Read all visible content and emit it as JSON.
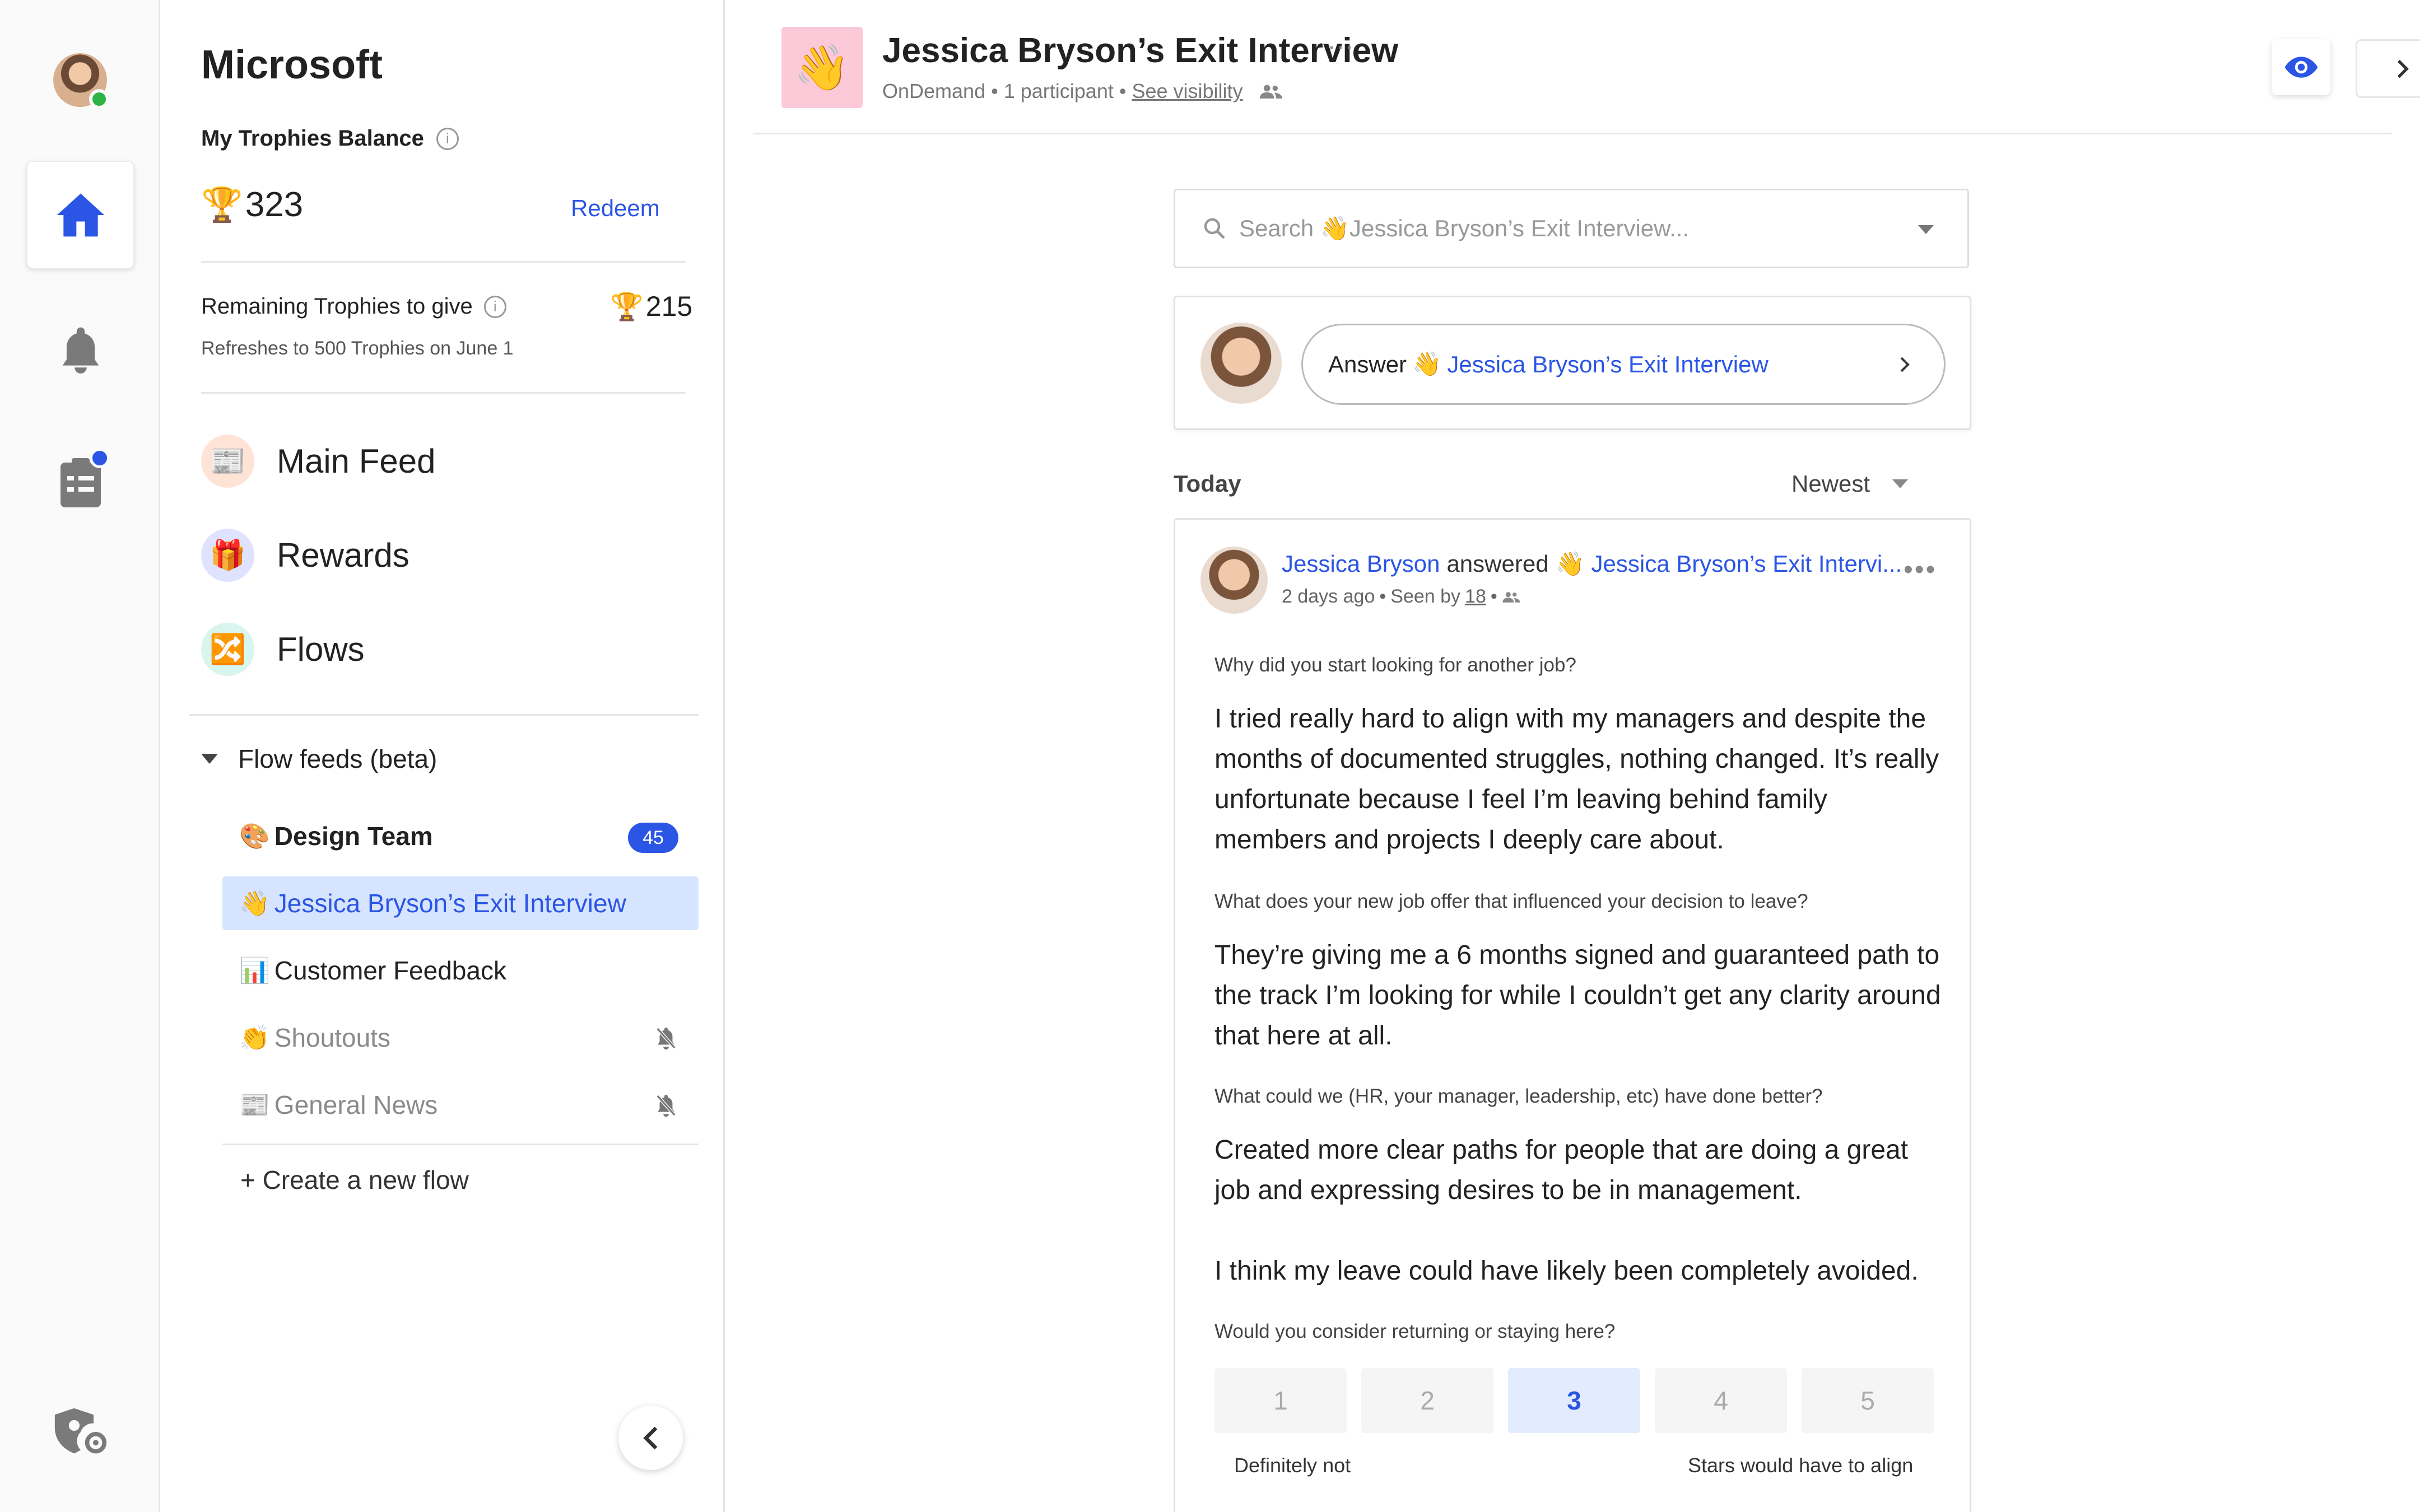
{
  "sidebar": {
    "org_name": "Microsoft",
    "balance_label": "My Trophies Balance",
    "balance_value": "323",
    "redeem_label": "Redeem",
    "remaining_label": "Remaining Trophies to give",
    "remaining_value": "215",
    "refresh_text": "Refreshes to 500 Trophies on June 1",
    "nav": [
      {
        "label": "Main Feed",
        "icon": "newspaper-icon"
      },
      {
        "label": "Rewards",
        "icon": "gift-icon"
      },
      {
        "label": "Flows",
        "icon": "flows-icon"
      }
    ],
    "flow_feeds_label": "Flow feeds (beta)",
    "flows": [
      {
        "emoji": "🎨",
        "label": "Design Team",
        "badge": "45"
      },
      {
        "emoji": "👋",
        "label": "Jessica Bryson’s Exit Interview"
      },
      {
        "emoji": "📊",
        "label": "Customer Feedback"
      },
      {
        "emoji": "👏",
        "label": "Shoutouts"
      },
      {
        "emoji": "📰",
        "label": "General News"
      }
    ],
    "create_label": "+ Create a new flow"
  },
  "header": {
    "emoji": "👋",
    "title": "Jessica Bryson’s Exit Interview",
    "more": "···",
    "meta_type": "OnDemand",
    "meta_sep": "•",
    "meta_participants": "1 participant",
    "meta_visibility": "See visibility"
  },
  "search": {
    "placeholder_prefix": "Search",
    "emoji": "👋",
    "placeholder_suffix": "Jessica Bryson’s Exit Interview..."
  },
  "answer": {
    "prefix": "Answer",
    "emoji": "👋",
    "title": "Jessica Bryson’s Exit Interview"
  },
  "feed": {
    "section_label": "Today",
    "sort_label": "Newest"
  },
  "post": {
    "author": "Jessica Bryson",
    "verb": "answered",
    "emoji": "👋",
    "flow": "Jessica Bryson’s Exit Intervi...",
    "time": "2 days ago",
    "sep": "•",
    "seen_prefix": "Seen by",
    "seen_count": "18",
    "more": "•••",
    "qa": [
      {
        "q": "Why did you start looking for another job?",
        "a": "I tried really hard to align with my managers and despite the months of documented struggles, nothing changed. It’s really unfortunate because I feel I’m leaving behind family members and projects I deeply care about."
      },
      {
        "q": "What does your new job offer that influenced your decision to leave?",
        "a": "They’re giving me a 6 months signed and guaranteed path to the track I’m looking for while I couldn’t get any clarity around that here at all."
      },
      {
        "q": "What could we (HR, your manager, leadership, etc) have done better?",
        "a": "Created more clear paths for people that are doing a great job and expressing desires to be in management.",
        "a2": "I think my leave could have likely been completely avoided."
      }
    ],
    "scale_question": "Would you consider returning or staying here?",
    "scale_options": [
      "1",
      "2",
      "3",
      "4",
      "5"
    ],
    "scale_selected": "3",
    "scale_low": "Definitely not",
    "scale_high": "Stars would have to align"
  },
  "colors": {
    "accent": "#2a55e5",
    "active_flow_bg": "#d6e4ff",
    "online": "#2fb344"
  }
}
